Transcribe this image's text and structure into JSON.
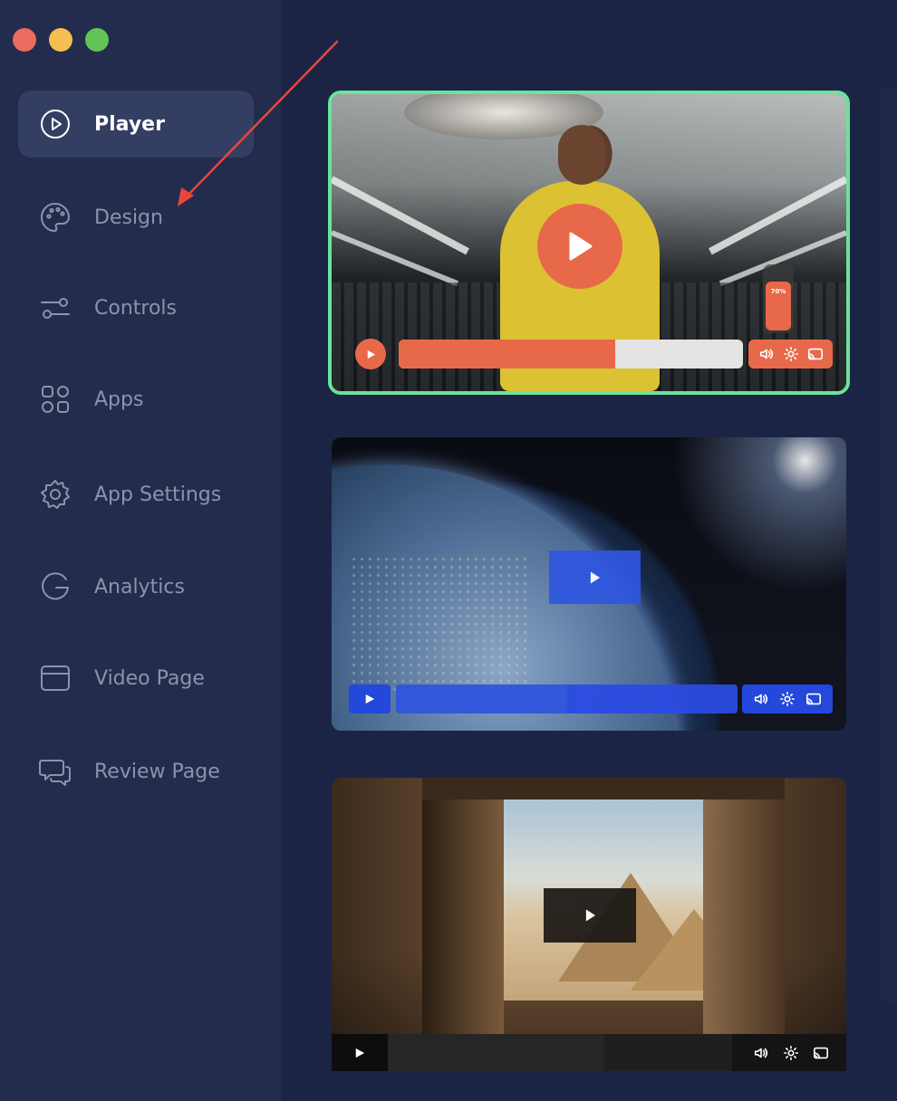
{
  "sidebar": {
    "items": [
      {
        "label": "Player",
        "icon": "play-circle-icon",
        "active": true
      },
      {
        "label": "Design",
        "icon": "palette-icon",
        "active": false
      },
      {
        "label": "Controls",
        "icon": "sliders-icon",
        "active": false
      },
      {
        "label": "Apps",
        "icon": "apps-grid-icon",
        "active": false
      },
      {
        "label": "App Settings",
        "icon": "gear-icon",
        "active": false
      },
      {
        "label": "Analytics",
        "icon": "g-logo-icon",
        "active": false
      },
      {
        "label": "Video Page",
        "icon": "browser-window-icon",
        "active": false
      },
      {
        "label": "Review Page",
        "icon": "chat-bubbles-icon",
        "active": false
      }
    ]
  },
  "players": [
    {
      "theme": "orange",
      "selected": true,
      "progress": 0.63,
      "volume_label": "70%",
      "volume": 0.7,
      "accent": "#e8694a"
    },
    {
      "theme": "blue",
      "selected": false,
      "progress": 0.5,
      "accent": "#2348db"
    },
    {
      "theme": "dark",
      "selected": false,
      "progress": 0.63,
      "accent": "#141414"
    }
  ],
  "colors": {
    "sidebar_bg": "#232c4d",
    "main_bg": "#1c2445",
    "selected_outline": "#6be39b",
    "annotation_arrow": "#e8473a"
  }
}
